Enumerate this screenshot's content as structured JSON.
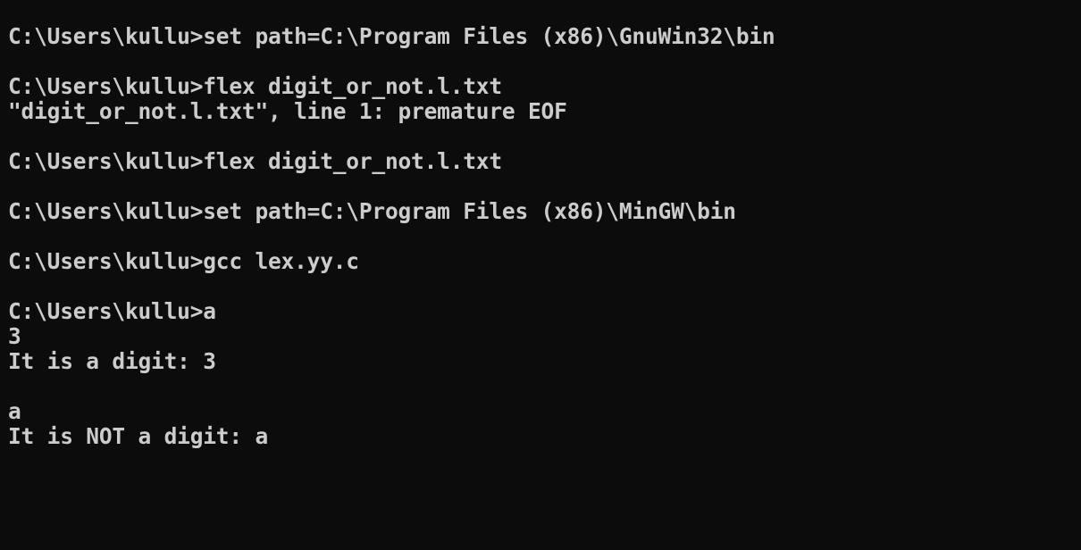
{
  "terminal": {
    "lines": [
      "C:\\Users\\kullu>set path=C:\\Program Files (x86)\\GnuWin32\\bin",
      "",
      "C:\\Users\\kullu>flex digit_or_not.l.txt",
      "\"digit_or_not.l.txt\", line 1: premature EOF",
      "",
      "C:\\Users\\kullu>flex digit_or_not.l.txt",
      "",
      "C:\\Users\\kullu>set path=C:\\Program Files (x86)\\MinGW\\bin",
      "",
      "C:\\Users\\kullu>gcc lex.yy.c",
      "",
      "C:\\Users\\kullu>a",
      "3",
      "It is a digit: 3",
      "",
      "a",
      "It is NOT a digit: a"
    ]
  },
  "colors": {
    "background": "#0c0c0c",
    "text": "#cccccc"
  }
}
